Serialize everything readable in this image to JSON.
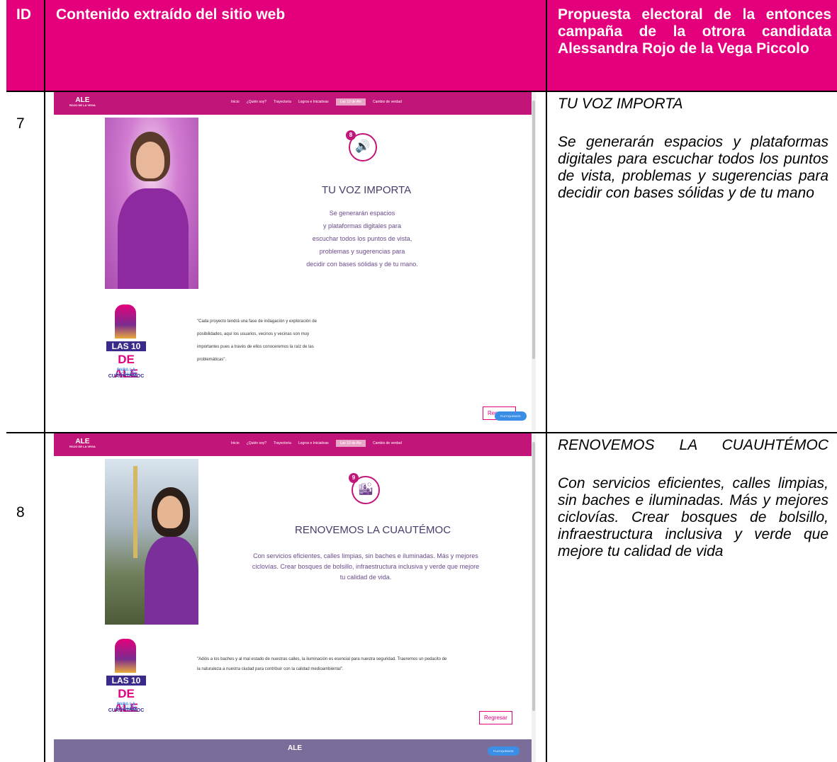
{
  "header": {
    "id": "ID",
    "content": "Contenido extraído del sitio web",
    "proposal": "Propuesta electoral de la entonces campaña de la otrora candidata Alessandra Rojo de la Vega Piccolo"
  },
  "colors": {
    "header_bg": "#e4007c",
    "nav_bg": "#c2157a",
    "footer_bg": "#7b6d9a"
  },
  "rows": [
    {
      "id": "7",
      "proposal_title": "TU VOZ IMPORTA",
      "proposal_text": "Se generarán espacios y plataformas digitales para escuchar todos los puntos de vista, problemas y sugerencias para decidir con bases sólidas y de tu mano",
      "screenshot": {
        "logo": "ALE",
        "logo_sub": "ROJO DE LA VEGA",
        "nav": [
          "Inicio",
          "¿Quién soy?",
          "Trayectoria",
          "Logros e Iniciativas",
          "Las 10 de Ale",
          "Cambio de verdad"
        ],
        "badge_number": "8",
        "badge_icon": "speaker-icon",
        "title": "TU VOZ IMPORTA",
        "body_lines": [
          "Se generarán espacios",
          "y plataformas digitales para",
          "escuchar todos los puntos de vista,",
          "problemas y sugerencias para",
          "decidir con bases sólidas y de tu mano."
        ],
        "poster": [
          "LAS 10",
          "DE ALE",
          "PARA LA ALCALDÍA",
          "CUAUHTÉMOC"
        ],
        "quote_lines": [
          "\"Cada proyecto tendrá una fase de indagación y exploración de",
          "posibilidades, aquí los usuarios, vecinos y vecinas son muy",
          "importantes pues a través de ellos conoceremos la raíz de las",
          "problemáticas\"."
        ],
        "back_button": "Regresar",
        "chat_button": "PLATIQUEMOS"
      }
    },
    {
      "id": "8",
      "proposal_title": "RENOVEMOS LA CUAUHTÉMOC",
      "proposal_text": "Con servicios eficientes, calles limpias, sin baches e iluminadas. Más y mejores ciclovías. Crear bosques de bolsillo, infraestructura inclusiva y verde que mejore tu calidad de vida",
      "screenshot": {
        "logo": "ALE",
        "logo_sub": "ROJO DE LA VEGA",
        "nav": [
          "Inicio",
          "¿Quién soy?",
          "Trayectoria",
          "Logros e Iniciativas",
          "Las 10 de Ale",
          "Cambio de verdad"
        ],
        "badge_number": "9",
        "badge_icon": "city-tree-icon",
        "title": "RENOVEMOS LA CUAUTÉMOC",
        "body_lines": [
          "Con servicios eficientes, calles limpias, sin baches e iluminadas. Más y mejores",
          "ciclovías. Crear bosques de bolsillo, infraestructura inclusiva y verde que mejore",
          "tu calidad de vida."
        ],
        "poster": [
          "LAS 10",
          "DE ALE",
          "PARA LA ALCALDÍA",
          "CUAUHTÉMOC"
        ],
        "quote_lines": [
          "\"Adiós a los baches y al mal estado de nuestras calles, la iluminación es esencial para nuestra seguridad. Traeremos un pedacito de",
          "la naturaleza a nuestra ciudad para contribuir con la calidad medioambiental\"."
        ],
        "back_button": "Regresar",
        "chat_button": "PLATIQUEMOS",
        "footer_logo": "ALE"
      }
    }
  ]
}
